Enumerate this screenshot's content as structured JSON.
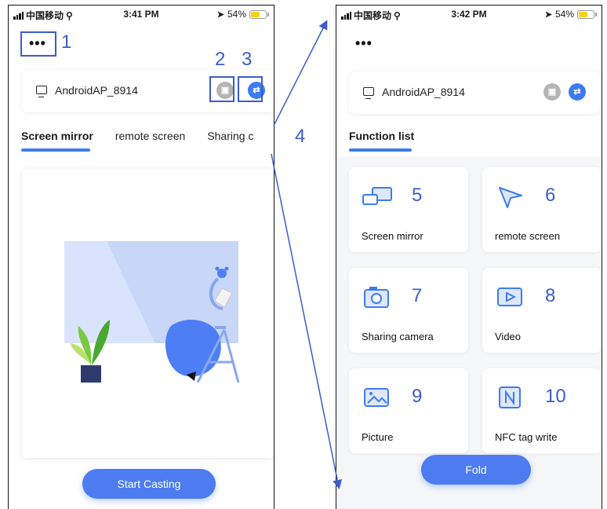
{
  "left_screen": {
    "status": {
      "carrier": "中国移动",
      "time": "3:41 PM",
      "battery": "54%"
    },
    "more_label": "•••",
    "device": {
      "name": "AndroidAP_8914",
      "monitor_icon": "monitor-icon",
      "cast_icon": "cast-icon",
      "switch_icon": "swap-arrows-icon"
    },
    "tabs": [
      {
        "label": "Screen mirror",
        "active": true
      },
      {
        "label": "remote screen",
        "active": false
      },
      {
        "label": "Sharing c",
        "active": false
      }
    ],
    "primary_button": "Start Casting"
  },
  "right_screen": {
    "status": {
      "carrier": "中国移动",
      "time": "3:42 PM",
      "battery": "54%"
    },
    "more_label": "•••",
    "device": {
      "name": "AndroidAP_8914"
    },
    "section_title": "Function list",
    "functions": [
      {
        "label": "Screen mirror",
        "number": "5",
        "icon": "screen-mirror-icon"
      },
      {
        "label": "remote screen",
        "number": "6",
        "icon": "cursor-arrow-icon"
      },
      {
        "label": "Sharing camera",
        "number": "7",
        "icon": "camera-icon"
      },
      {
        "label": "Video",
        "number": "8",
        "icon": "play-video-icon"
      },
      {
        "label": "Picture",
        "number": "9",
        "icon": "picture-icon"
      },
      {
        "label": "NFC tag write",
        "number": "10",
        "icon": "nfc-icon"
      }
    ],
    "primary_button": "Fold"
  },
  "annotations": {
    "a1": "1",
    "a2": "2",
    "a3": "3",
    "a4": "4"
  },
  "colors": {
    "accent": "#3d7cf0",
    "annotation": "#3d5cc8",
    "battery": "#f5d21a"
  }
}
